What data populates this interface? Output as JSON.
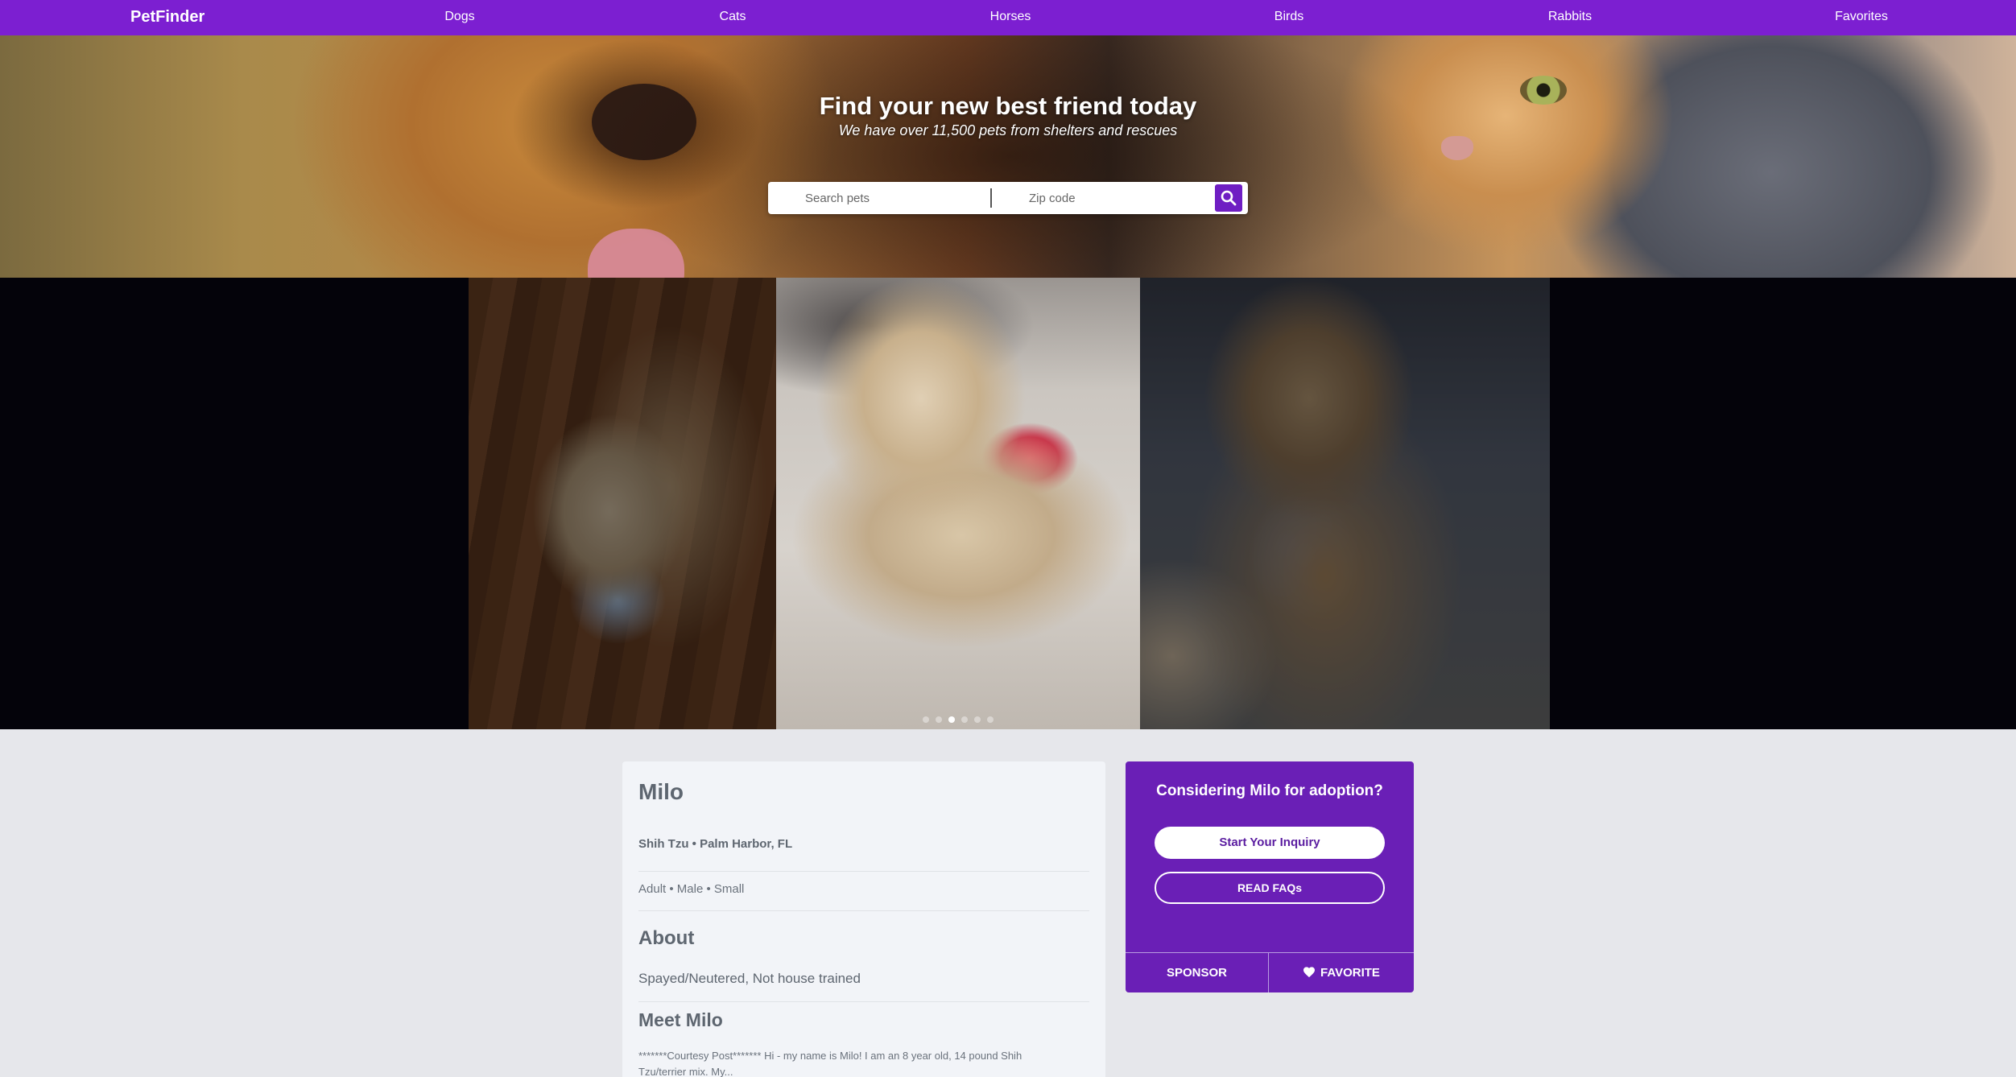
{
  "nav": {
    "brand": "PetFinder",
    "links": [
      "Dogs",
      "Cats",
      "Horses",
      "Birds",
      "Rabbits",
      "Favorites"
    ]
  },
  "hero": {
    "title": "Find your new best friend today",
    "subtitle": "We have over 11,500 pets from shelters and rescues",
    "search_placeholder": "Search pets",
    "zip_placeholder": "Zip code",
    "search_icon": "magnifier-icon"
  },
  "gallery": {
    "photos": 3,
    "dots_total": 6,
    "active_dot": 3
  },
  "pet": {
    "name": "Milo",
    "breed_location": "Shih Tzu • Palm Harbor, FL",
    "attributes": "Adult • Male • Small",
    "about_heading": "About",
    "about_text": "Spayed/Neutered, Not house trained",
    "meet_heading": "Meet Milo",
    "meet_text": "*******Courtesy Post******* Hi - my name is Milo! I am an 8 year old, 14 pound Shih Tzu/terrier mix. My..."
  },
  "adoption": {
    "question": "Considering Milo for adoption?",
    "inquiry_button": "Start Your Inquiry",
    "faq_button": "READ FAQs",
    "sponsor_button": "SPONSOR",
    "favorite_button": "FAVORITE",
    "favorite_icon": "heart-icon",
    "accent_color": "#6a1fb6"
  },
  "colors": {
    "nav": "#7c1fd1",
    "page_background": "#e6e7eb"
  }
}
